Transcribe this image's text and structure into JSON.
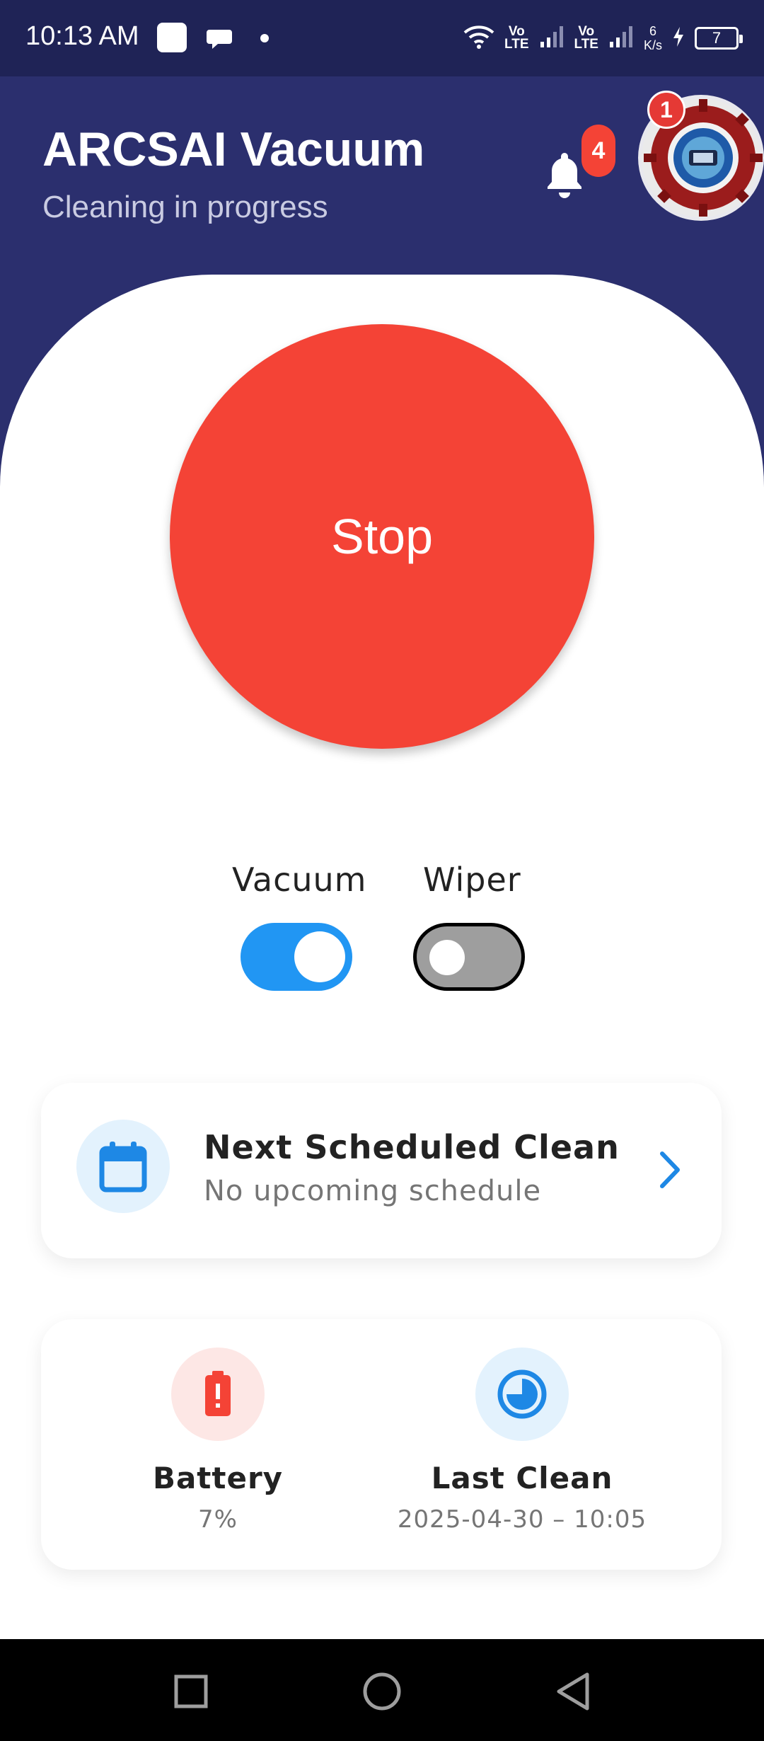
{
  "status_bar": {
    "time": "10:13 AM",
    "network_1": {
      "top": "Vo",
      "bottom": "LTE"
    },
    "network_2": {
      "top": "Vo",
      "bottom": "LTE"
    },
    "net_speed": {
      "value": "6",
      "unit": "K/s"
    },
    "battery_level": "7"
  },
  "header": {
    "title": "ARCSAI Vacuum",
    "subtitle": "Cleaning in progress",
    "notification_count": "4",
    "avatar_badge": "1"
  },
  "main": {
    "stop_label": "Stop",
    "toggles": [
      {
        "label": "Vacuum",
        "on": true
      },
      {
        "label": "Wiper",
        "on": false
      }
    ]
  },
  "schedule_card": {
    "title": "Next Scheduled Clean",
    "subtitle": "No upcoming schedule"
  },
  "stats": {
    "battery": {
      "label": "Battery",
      "value": "7%"
    },
    "last_clean": {
      "label": "Last Clean",
      "value": "2025-04-30 – 10:05"
    }
  },
  "colors": {
    "header_bg": "#2b2f6e",
    "stop_red": "#f44336",
    "accent_blue": "#2196f3"
  }
}
